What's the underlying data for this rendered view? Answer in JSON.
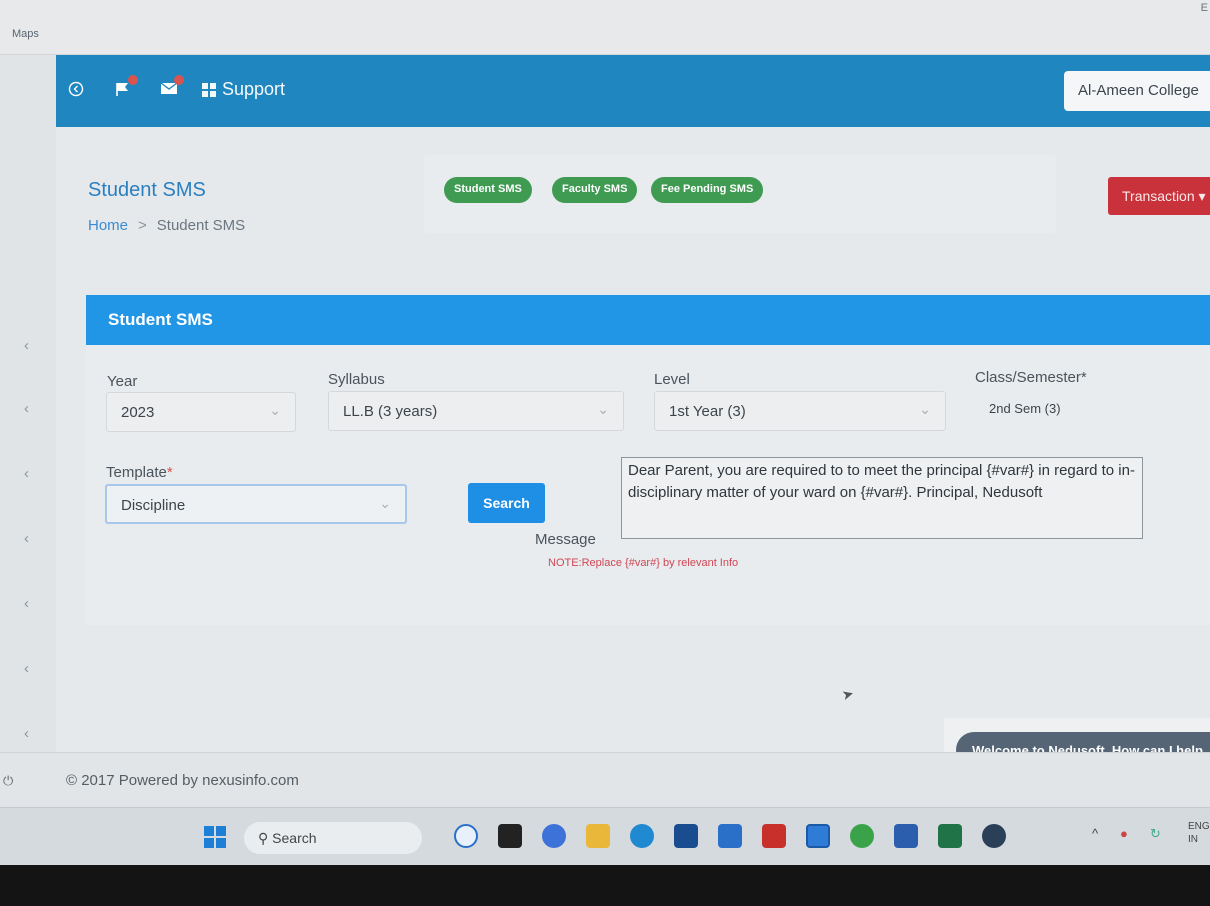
{
  "window": {
    "top_label": "Maps",
    "corner_label": "E"
  },
  "header": {
    "support_label": "Support",
    "college_name": "Al-Ameen College"
  },
  "page": {
    "title": "Student SMS",
    "breadcrumb": {
      "home": "Home",
      "separator": ">",
      "current": "Student SMS"
    },
    "pills": [
      "Student SMS",
      "Faculty SMS",
      "Fee Pending SMS"
    ],
    "transaction_label": "Transaction"
  },
  "form": {
    "card_title": "Student SMS",
    "year": {
      "label": "Year",
      "value": "2023"
    },
    "syllabus": {
      "label": "Syllabus",
      "value": "LL.B (3 years)"
    },
    "level": {
      "label": "Level",
      "value": "1st Year (3)"
    },
    "class_semester": {
      "label": "Class/Semester",
      "required_mark": "*",
      "value": "2nd Sem (3)"
    },
    "template": {
      "label": "Template",
      "required_mark": "*",
      "value": "Discipline"
    },
    "search_label": "Search",
    "message_label": "Message",
    "message_text": "Dear Parent, you are required to to meet the principal {#var#} in regard to in-disciplinary matter of your ward on {#var#}. Principal, Nedusoft",
    "note": "NOTE:Replace {#var#} by relevant Info"
  },
  "chat": {
    "welcome": "Welcome to Nedusoft. How can I help"
  },
  "footer": {
    "copyright": "© 2017 Powered by nexusinfo.com"
  },
  "taskbar": {
    "search_label": "Search",
    "lang_line1": "ENG",
    "lang_line2": "IN"
  },
  "icons": {
    "back": "circle-arrow-left-icon",
    "flag": "flag-notification-icon",
    "mail": "mail-notification-icon",
    "grid": "grid-icon",
    "caret": "chevron-down-icon"
  },
  "colors": {
    "header": "#1f86c0",
    "card_header": "#2196e6",
    "pill": "#3f9a52",
    "transaction": "#c9323a",
    "search": "#1f8fe5",
    "note": "#d04655",
    "chat": "#566575"
  }
}
